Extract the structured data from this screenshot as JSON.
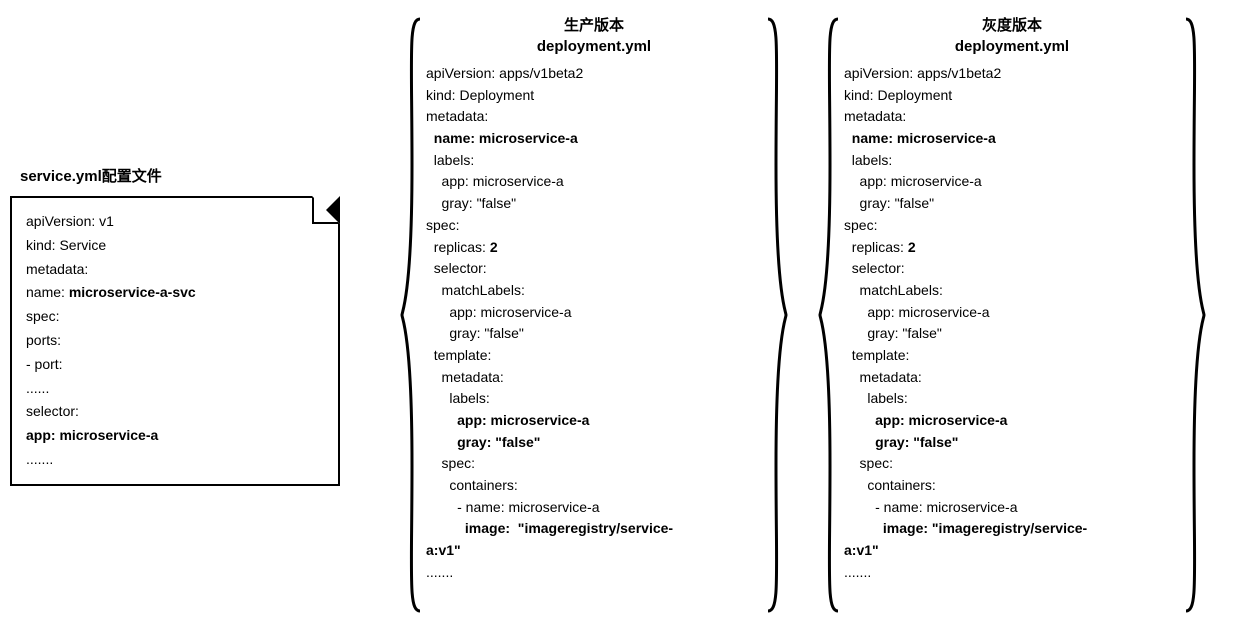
{
  "left": {
    "title": "service.yml配置文件",
    "l1": "apiVersion: v1",
    "l2": "kind: Service",
    "l3": "metadata:",
    "l4": " name: ",
    "l4b": "microservice-a-svc",
    "l5": "spec:",
    "l6": " ports:",
    "l7": "   - port:",
    "l8": "    ......",
    "l9": " selector:",
    "l10": "   app: microservice-a",
    "l11": "......."
  },
  "prod": {
    "title1": "生产版本",
    "title2": "deployment.yml",
    "y1": "apiVersion: apps/v1beta2",
    "y2": "kind: Deployment",
    "y3": "metadata:",
    "y4": "  name: microservice-a",
    "y5": "  labels:",
    "y6": "    app: microservice-a",
    "y7": "    gray: \"false\"",
    "y8": "spec:",
    "y9": "  replicas: ",
    "y9b": "2",
    "y10": "  selector:",
    "y11": "    matchLabels:",
    "y12": "      app: microservice-a",
    "y13": "      gray: \"false\"",
    "y14": "  template:",
    "y15": "    metadata:",
    "y16": "      labels:",
    "y17": "        app: microservice-a",
    "y18": "        gray: \"false\"",
    "y19": "    spec:",
    "y20": "      containers:",
    "y21": "        - name: microservice-a",
    "y22a": "          image:  \"imageregistry/service-",
    "y22b": "a:v1\"",
    "y23": "......."
  },
  "gray": {
    "title1": "灰度版本",
    "title2": "deployment.yml",
    "y1": "apiVersion: apps/v1beta2",
    "y2": "kind: Deployment",
    "y3": "metadata:",
    "y4": "  name: microservice-a",
    "y5": "  labels:",
    "y6": "    app: microservice-a",
    "y7": "    gray: \"false\"",
    "y8": "spec:",
    "y9": "  replicas: ",
    "y9b": "2",
    "y10": "  selector:",
    "y11": "    matchLabels:",
    "y12": "      app: microservice-a",
    "y13": "      gray: \"false\"",
    "y14": "  template:",
    "y15": "    metadata:",
    "y16": "      labels:",
    "y17": "        app: microservice-a",
    "y18": "        gray: \"false\"",
    "y19": "    spec:",
    "y20": "      containers:",
    "y21": "        - name: microservice-a",
    "y22a": "          image: \"imageregistry/service-",
    "y22b": "a:v1\"",
    "y23": "......."
  }
}
